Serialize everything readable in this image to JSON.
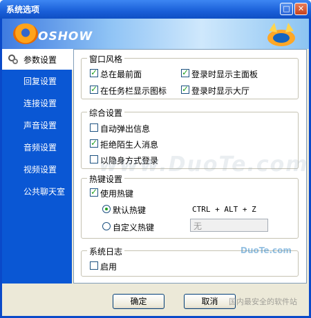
{
  "window": {
    "title": "系统选项"
  },
  "titlebar_buttons": {
    "restore": "□",
    "close": "✕"
  },
  "banner": {
    "brand": "OSHOW"
  },
  "sidebar": {
    "items": [
      {
        "label": "参数设置",
        "active": true
      },
      {
        "label": "回复设置"
      },
      {
        "label": "连接设置"
      },
      {
        "label": "声音设置"
      },
      {
        "label": "音频设置"
      },
      {
        "label": "视频设置"
      },
      {
        "label": "公共聊天室"
      }
    ]
  },
  "window_style": {
    "title": "窗口风格",
    "options": [
      {
        "label": "总在最前面",
        "checked": true
      },
      {
        "label": "登录时显示主面板",
        "checked": true
      },
      {
        "label": "在任务栏显示图标",
        "checked": true
      },
      {
        "label": "登录时显示大厅",
        "checked": true
      }
    ]
  },
  "general": {
    "title": "综合设置",
    "options": [
      {
        "label": "自动弹出信息",
        "checked": false
      },
      {
        "label": "拒绝陌生人消息",
        "checked": true
      },
      {
        "label": "以隐身方式登录",
        "checked": false
      }
    ]
  },
  "hotkey": {
    "title": "热键设置",
    "use_label": "使用热键",
    "use_checked": true,
    "default_label": "默认热键",
    "default_value": "CTRL + ALT + Z",
    "custom_label": "自定义热键",
    "custom_value": "无"
  },
  "syslog": {
    "title": "系统日志",
    "enable_label": "启用",
    "enable_checked": false
  },
  "footer": {
    "ok": "确定",
    "cancel": "取消"
  },
  "watermarks": {
    "center": "www.DuoTe.com",
    "corner": "DuoTe.com",
    "corner2": "国内最安全的软件站"
  }
}
